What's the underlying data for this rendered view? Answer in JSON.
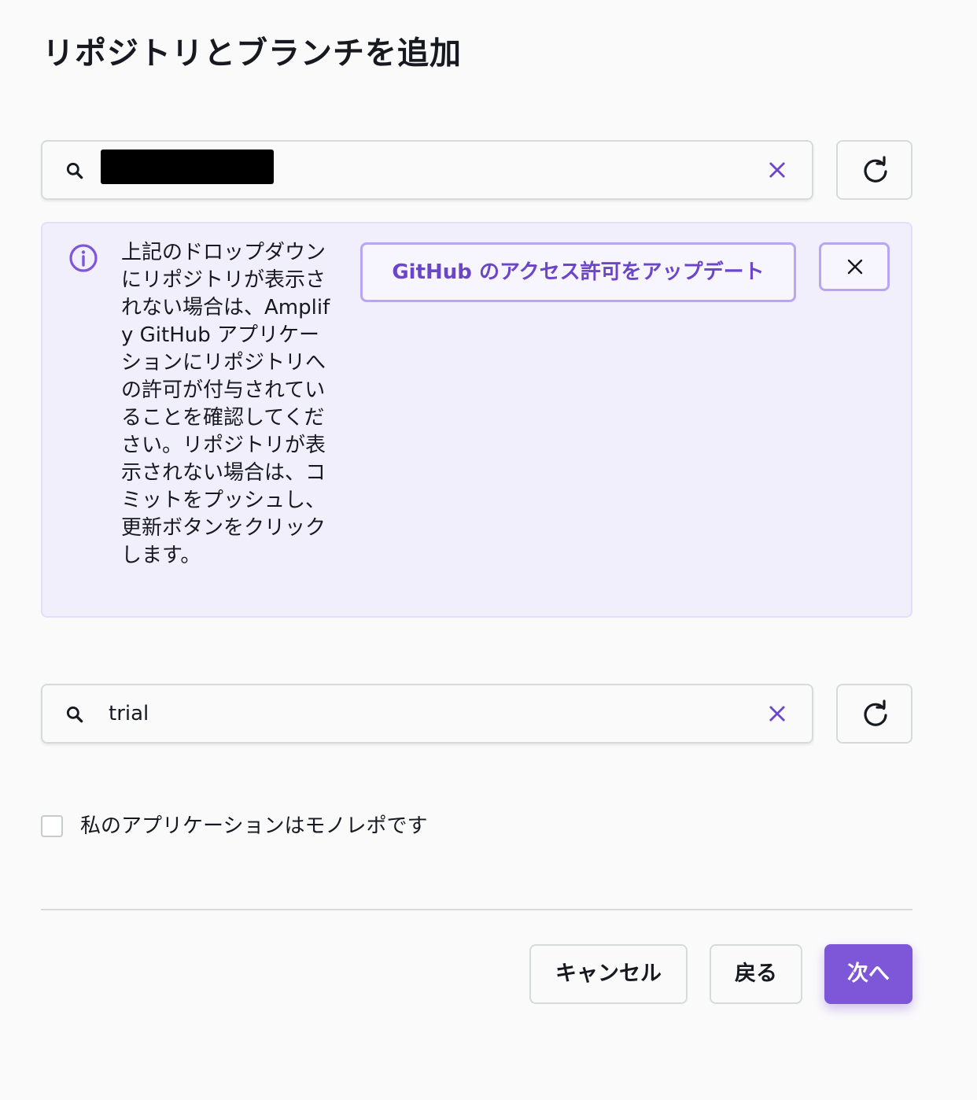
{
  "page": {
    "title": "リポジトリとブランチを追加"
  },
  "repo_search": {
    "value": "",
    "clear_icon": "close-icon",
    "search_icon": "search-icon",
    "refresh_icon": "refresh-icon"
  },
  "info_alert": {
    "text": "上記のドロップダウンにリポジトリが表示されない場合は、Amplify GitHub アプリケーションにリポジトリへの許可が付与されていることを確認してください。リポジトリが表示されない場合は、コミットをプッシュし、更新ボタンをクリックします。",
    "update_button": "GitHub のアクセス許可をアップデート",
    "icon": "info-icon",
    "dismiss_icon": "close-icon"
  },
  "branch_search": {
    "value": "trial"
  },
  "monorepo": {
    "label": "私のアプリケーションはモノレポです",
    "checked": false
  },
  "footer": {
    "cancel": "キャンセル",
    "back": "戻る",
    "next": "次へ"
  },
  "colors": {
    "accent": "#7e57d8",
    "alert_bg": "#f2effd",
    "alert_border": "#b9a6f2",
    "text": "#16191f"
  }
}
